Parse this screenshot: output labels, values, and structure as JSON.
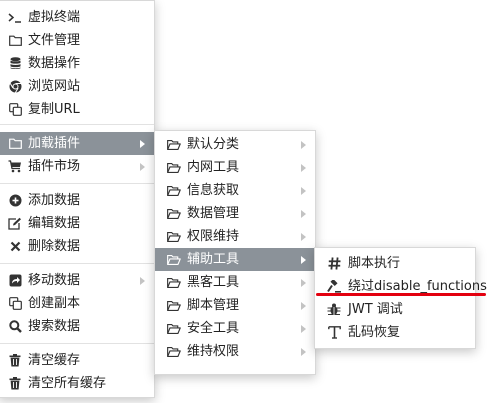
{
  "menu1": {
    "items": [
      {
        "label": "虚拟终端",
        "icon": "terminal-icon"
      },
      {
        "label": "文件管理",
        "icon": "folder-icon"
      },
      {
        "label": "数据操作",
        "icon": "database-icon"
      },
      {
        "label": "浏览网站",
        "icon": "chrome-icon"
      },
      {
        "label": "复制URL",
        "icon": "copy-icon"
      },
      {
        "label": "加载插件",
        "icon": "folder-icon",
        "active": true,
        "submenu": true
      },
      {
        "label": "插件市场",
        "icon": "cart-icon",
        "submenu": true
      },
      {
        "label": "添加数据",
        "icon": "plus-circle-icon"
      },
      {
        "label": "编辑数据",
        "icon": "edit-icon"
      },
      {
        "label": "删除数据",
        "icon": "close-icon"
      },
      {
        "label": "移动数据",
        "icon": "share-icon",
        "submenu": true
      },
      {
        "label": "创建副本",
        "icon": "copy-icon"
      },
      {
        "label": "搜索数据",
        "icon": "search-icon"
      },
      {
        "label": "清空缓存",
        "icon": "trash-icon"
      },
      {
        "label": "清空所有缓存",
        "icon": "trash-icon"
      }
    ]
  },
  "menu2": {
    "items": [
      {
        "label": "默认分类",
        "icon": "folder-open-icon"
      },
      {
        "label": "内网工具",
        "icon": "folder-open-icon"
      },
      {
        "label": "信息获取",
        "icon": "folder-open-icon"
      },
      {
        "label": "数据管理",
        "icon": "folder-open-icon"
      },
      {
        "label": "权限维持",
        "icon": "folder-open-icon"
      },
      {
        "label": "辅助工具",
        "icon": "folder-open-icon",
        "active": true
      },
      {
        "label": "黑客工具",
        "icon": "folder-open-icon"
      },
      {
        "label": "脚本管理",
        "icon": "folder-open-icon"
      },
      {
        "label": "安全工具",
        "icon": "folder-open-icon"
      },
      {
        "label": "维持权限",
        "icon": "folder-open-icon"
      }
    ]
  },
  "menu3": {
    "items": [
      {
        "label": "脚本执行",
        "icon": "hash-icon"
      },
      {
        "label": "绕过disable_functions",
        "icon": "gavel-icon"
      },
      {
        "label": "JWT 调试",
        "icon": "bug-icon"
      },
      {
        "label": "乱码恢复",
        "icon": "text-icon"
      }
    ]
  },
  "annotation": {
    "color": "#e3000f"
  },
  "colors": {
    "active_bg": "#8b9299",
    "arrow": "#c3c3c3"
  }
}
